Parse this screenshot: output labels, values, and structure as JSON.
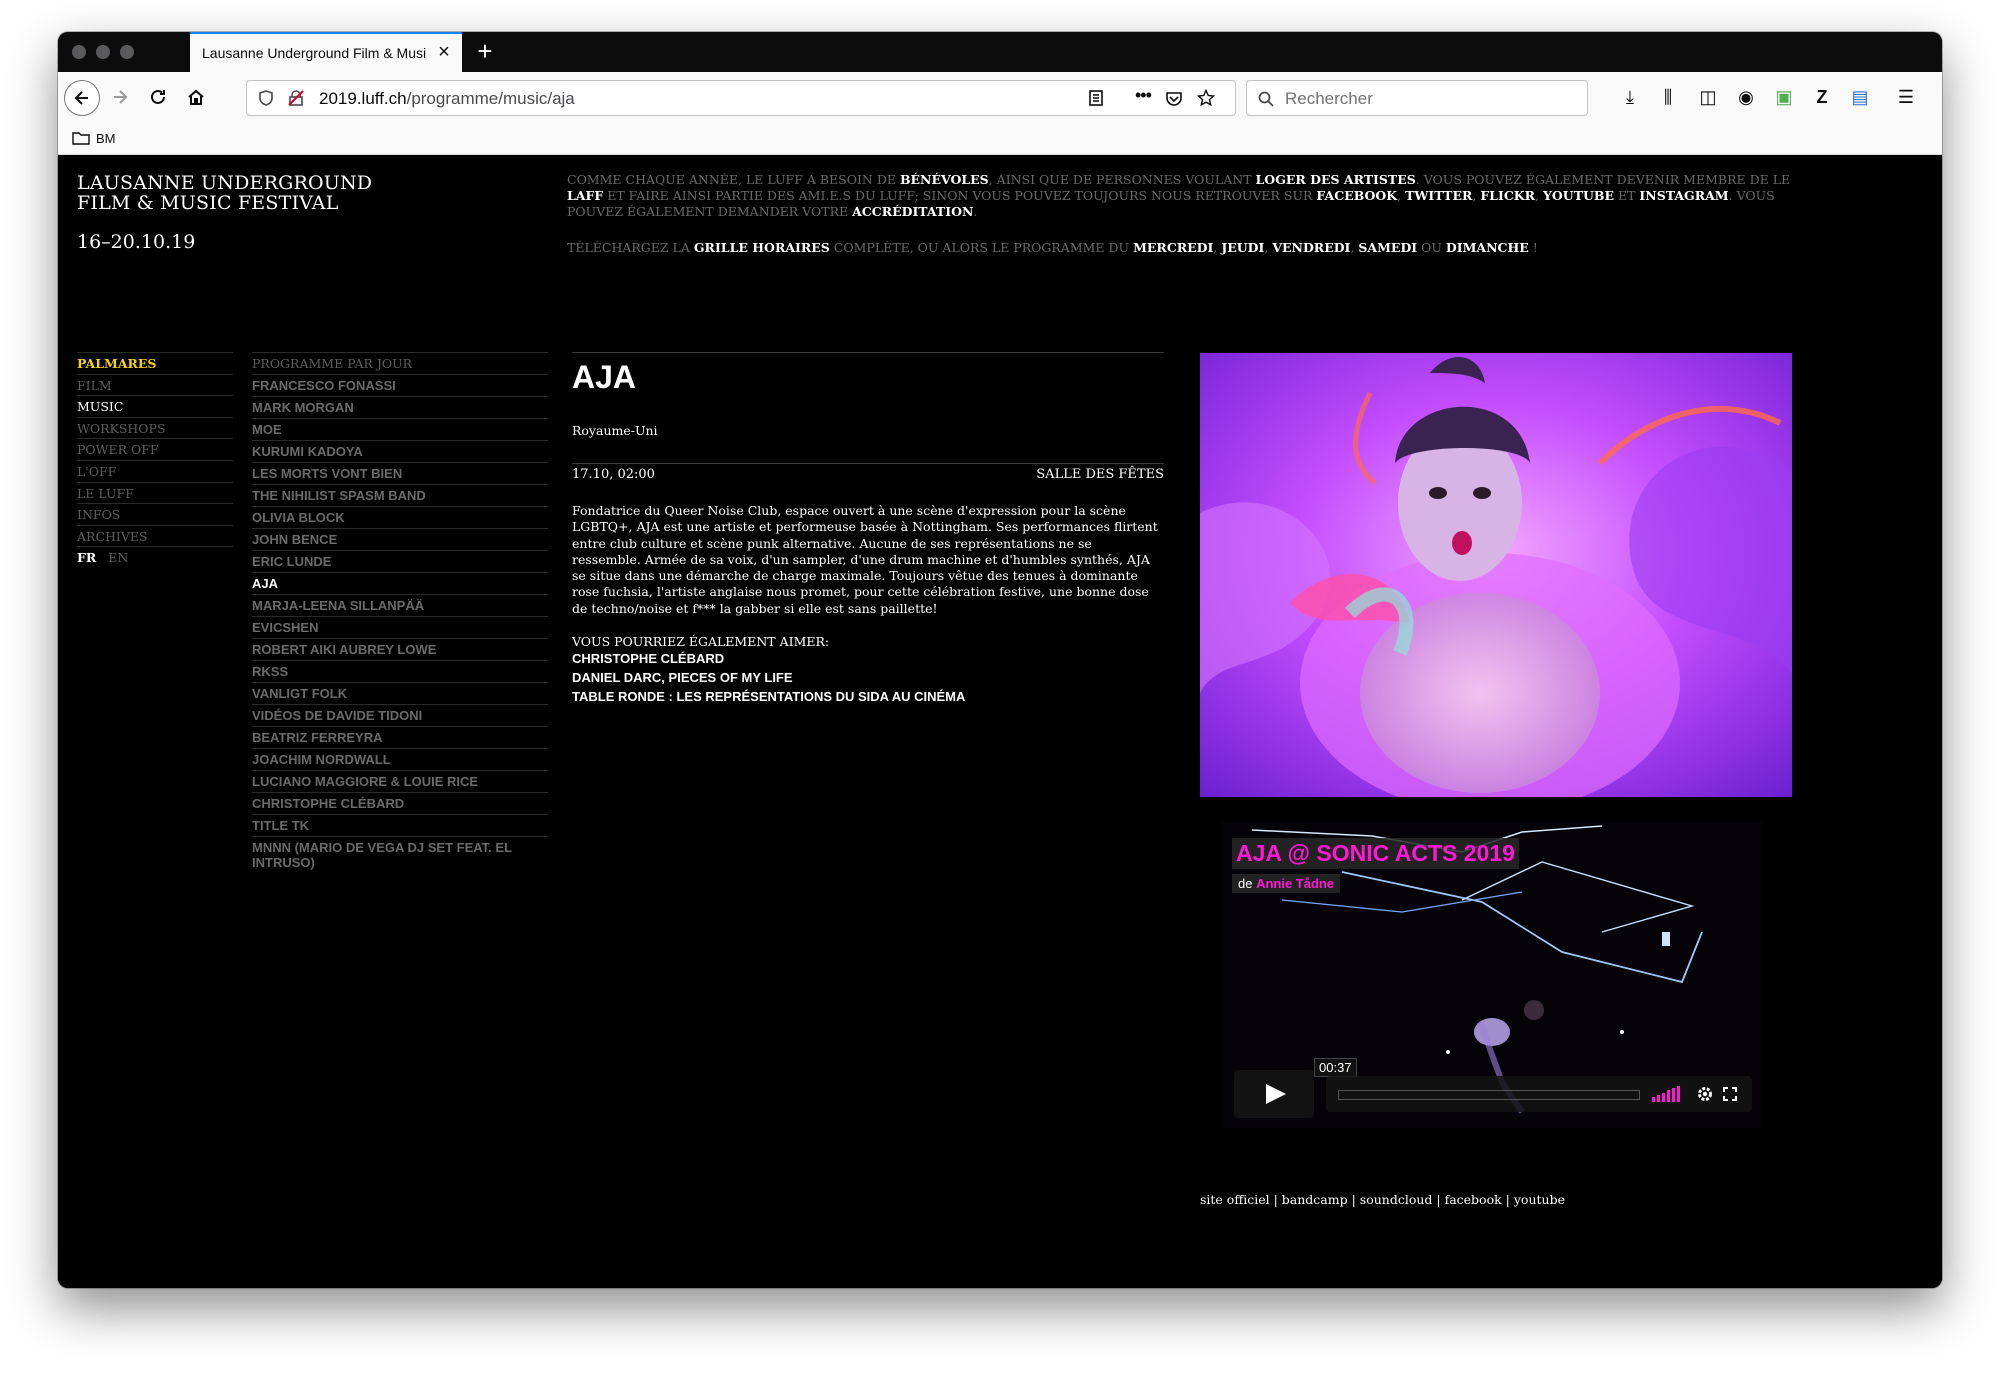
{
  "browser": {
    "tab_title": "Lausanne Underground Film & Musi",
    "url_host": "2019.luff.ch",
    "url_path": "/programme/music/aja",
    "search_placeholder": "Rechercher",
    "bookmark_label": "BM",
    "icons": [
      "back-icon",
      "forward-icon",
      "reload-icon",
      "home-icon",
      "shield-icon",
      "lock-icon",
      "reader-icon",
      "more-icon",
      "pocket-icon",
      "star-icon",
      "search-icon",
      "download-icon",
      "library-icon",
      "sidebar-icon",
      "account-icon",
      "extension-icon",
      "zotero-icon",
      "save-icon",
      "menu-icon",
      "folder-icon"
    ]
  },
  "site": {
    "title_line1": "LAUSANNE UNDERGROUND",
    "title_line2": "FILM & MUSIC FESTIVAL",
    "dates": "16–20.10.19"
  },
  "notice": {
    "p1": {
      "t1": "Comme chaque année, le LUFF a besoin de ",
      "l1": "bénévoles",
      "t2": ", ainsi que de personnes voulant ",
      "l2": "loger des artistes",
      "t3": ". Vous pouvez également devenir membre de le ",
      "l3": "LAFF",
      "t4": " et faire ainsi partie des ami.e.s du LUFF; sinon vous pouvez toujours nous retrouver sur ",
      "l4": "Facebook",
      "t5": ", ",
      "l5": "Twitter",
      "t6": ", ",
      "l6": "Flickr",
      "t7": ", ",
      "l7": "YouTube",
      "t8": " et ",
      "l8": "Instagram",
      "t9": ". Vous pouvez également demander votre ",
      "l9": "accréditation",
      "t10": "."
    },
    "p2": {
      "t1": "Téléchargez la ",
      "l1": "grille horaires",
      "t2": " complète, ou alors le programme du ",
      "l2": "mercredi",
      "t3": ", ",
      "l3": "jeudi",
      "t4": ", ",
      "l4": "vendredi",
      "t5": ", ",
      "l5": "samedi",
      "t6": " ou ",
      "l6": "dimanche",
      "t7": " !"
    }
  },
  "menu": {
    "items": [
      "PALMARES",
      "FILM",
      "MUSIC",
      "WORKSHOPS",
      "POWER OFF",
      "L'OFF",
      "LE LUFF",
      "INFOS",
      "ARCHIVES"
    ],
    "lang_fr": "FR",
    "lang_en": "EN"
  },
  "artists": {
    "header": "PROGRAMME PAR JOUR",
    "items": [
      "FRANCESCO FONASSI",
      "MARK MORGAN",
      "MOE",
      "KURUMI KADOYA",
      "LES MORTS VONT BIEN",
      "THE NIHILIST SPASM BAND",
      "OLIVIA BLOCK",
      "JOHN BENCE",
      "ERIC LUNDE",
      "AJA",
      "MARJA-LEENA SILLANPÄÄ",
      "EVICSHEN",
      "ROBERT AIKI AUBREY LOWE",
      "RKSS",
      "VANLIGT FOLK",
      "VIDÉOS DE DAVIDE TIDONI",
      "BEATRIZ FERREYRA",
      "JOACHIM NORDWALL",
      "LUCIANO MAGGIORE & LOUIE RICE",
      "CHRISTOPHE CLÉBARD",
      "TITLE TK",
      "MNNN (MARIO DE VEGA DJ SET FEAT. EL INTRUSO)"
    ],
    "active": "AJA"
  },
  "article": {
    "title": "AJA",
    "country": "Royaume-Uni",
    "datetime": "17.10, 02:00",
    "venue": "SALLE DES FÊTES",
    "description": "Fondatrice du Queer Noise Club, espace ouvert à une scène d'expression pour la scène LGBTQ+, AJA est une artiste et performeuse basée à Nottingham. Ses performances flirtent entre club culture et scène punk alternative. Aucune de ses représentations ne se ressemble. Armée de sa voix, d'un sampler, d'une drum machine et d'humbles synthés, AJA se situe dans une démarche de charge maximale. Toujours vêtue des tenues à dominante rose fuchsia, l'artiste anglaise nous promet, pour cette célébration festive, une bonne dose de techno/noise et f*** la gabber si elle est sans paillette!",
    "also_label": "VOUS POURRIEZ ÉGALEMENT AIMER:",
    "also_links": [
      "CHRISTOPHE CLÉBARD",
      "DANIEL DARC, PIECES OF MY LIFE",
      "TABLE RONDE : LES REPRÉSENTATIONS DU SIDA AU CINÉMA"
    ]
  },
  "video": {
    "title": "AJA @ SONIC ACTS 2019",
    "by_prefix": "de ",
    "by_name": "Annie Tådne",
    "time": "00:37",
    "accent": "#ff17d6"
  },
  "links": {
    "l1": "site officiel",
    "sep": " | ",
    "l2": "bandcamp",
    "l3": "soundcloud",
    "l4": "facebook",
    "l5": "youtube"
  },
  "colors": {
    "accent_yellow": "#f4d31a",
    "tab_accent": "#0a84ff"
  }
}
